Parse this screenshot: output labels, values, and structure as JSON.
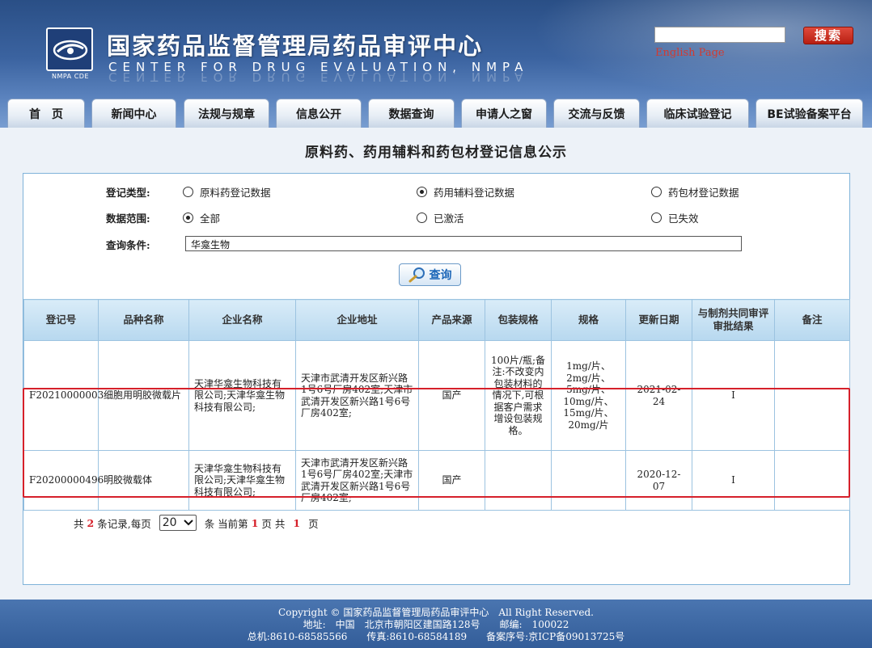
{
  "header": {
    "logo_caption": "NMPA CDE",
    "title_cn": "国家药品监督管理局药品审评中心",
    "title_en": "CENTER FOR DRUG EVALUATION, NMPA",
    "search_placeholder": "",
    "search_button": "搜索",
    "english_link": "English Page"
  },
  "nav": [
    "首　页",
    "新闻中心",
    "法规与规章",
    "信息公开",
    "数据查询",
    "申请人之窗",
    "交流与反馈",
    "临床试验登记",
    "BE试验备案平台"
  ],
  "page_heading": "原料药、药用辅料和药包材登记信息公示",
  "form": {
    "type_label": "登记类型:",
    "type_options": [
      "原料药登记数据",
      "药用辅料登记数据",
      "药包材登记数据"
    ],
    "type_selected": 1,
    "scope_label": "数据范围:",
    "scope_options": [
      "全部",
      "已激活",
      "已失效"
    ],
    "scope_selected": 0,
    "query_label": "查询条件:",
    "query_value": "华龛生物",
    "query_button": "查询"
  },
  "table": {
    "headers": [
      "登记号",
      "品种名称",
      "企业名称",
      "企业地址",
      "产品来源",
      "包装规格",
      "规格",
      "更新日期",
      "与制剂共同审评审批结果",
      "备注"
    ],
    "rows": [
      {
        "reg_no": "F20210000003",
        "name": "细胞用明胶微载片",
        "company": "天津华龛生物科技有限公司;天津华龛生物科技有限公司;",
        "address": "天津市武清开发区新兴路1号6号厂房402室;天津市武清开发区新兴路1号6号厂房402室;",
        "source": "国产",
        "package": "100片/瓶;备注:不改变内包装材料的情况下,可根据客户需求增设包装规格。",
        "spec": "1mg/片、2mg/片、5mg/片、10mg/片、15mg/片、20mg/片",
        "date": "2021-02-24",
        "result": "I",
        "note": ""
      },
      {
        "reg_no": "F20200000496",
        "name": "明胶微载体",
        "company": "天津华龛生物科技有限公司;天津华龛生物科技有限公司;",
        "address": "天津市武清开发区新兴路1号6号厂房402室;天津市武清开发区新兴路1号6号厂房402室;",
        "source": "国产",
        "package": "",
        "spec": "",
        "date": "2020-12-07",
        "result": "I",
        "note": ""
      }
    ]
  },
  "pager": {
    "prefix": "共",
    "total": "2",
    "records_per_page": "条记录,每页",
    "page_size": "20",
    "current_prefix": "条 当前第",
    "current": "1",
    "page_of": "页 共",
    "pages": "1",
    "page_suffix": "页"
  },
  "footer": {
    "line1": "Copyright © 国家药品监督管理局药品审评中心　All Right Reserved.",
    "line2": "地址:　中国　北京市朝阳区建国路128号　　邮编:　100022",
    "line3": "总机:8610-68585566　　传真:8610-68584189　　备案序号:京ICP备09013725号"
  },
  "colors": {
    "highlight": "#d6202a",
    "header_bg": "#2a4f86"
  }
}
